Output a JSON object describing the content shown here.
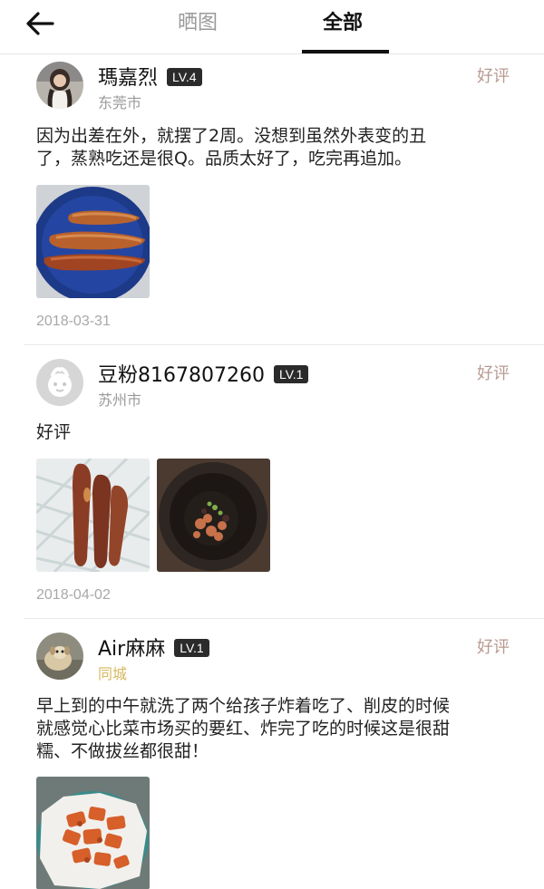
{
  "header": {
    "tabs": [
      {
        "label": "晒图"
      },
      {
        "label": "全部"
      }
    ]
  },
  "reviews": [
    {
      "username": "瑪嘉烈",
      "level": "LV.4",
      "city": "东莞市",
      "rating": "好评",
      "text_lines": [
        "因为出差在外，就摆了2周。没想到虽然外表变的丑",
        "了，蒸熟吃还是很Q。品质太好了，吃完再追加。"
      ],
      "photos": [
        "steamed-sweet-potatoes-on-blue-plate"
      ],
      "date": "2018-03-31"
    },
    {
      "username": "豆粉8167807260",
      "level": "LV.1",
      "city": "苏州市",
      "rating": "好评",
      "text_lines": [
        "好评"
      ],
      "photos": [
        "raw-sweet-potatoes-in-foam-net",
        "fried-sweet-potato-pieces-in-wok"
      ],
      "date": "2018-04-02"
    },
    {
      "username": "Air麻麻",
      "level": "LV.1",
      "city": "同城",
      "rating": "好评",
      "text_lines": [
        "早上到的中午就洗了两个给孩子炸着吃了、削皮的时候",
        "就感觉心比菜市场买的要红、炸完了吃的时候这是很甜",
        "糯、不做拔丝都很甜！"
      ],
      "photos": [
        "fried-sweet-potato-chunks-on-paper"
      ],
      "date": ""
    }
  ]
}
